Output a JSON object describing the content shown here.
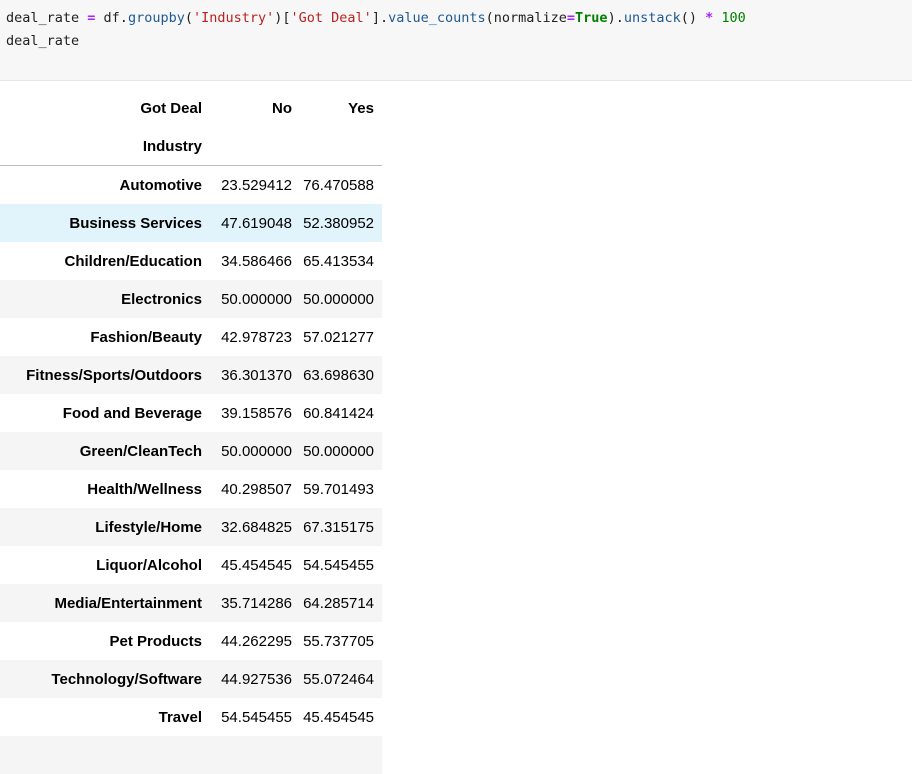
{
  "code": {
    "line1": {
      "var": "deal_rate ",
      "eq": "=",
      "obj": " df.",
      "fn1": "groupby",
      "p1": "(",
      "str1": "'Industry'",
      "p2": ")[",
      "str2": "'Got Deal'",
      "p3": "].",
      "fn2": "value_counts",
      "p4": "(normalize",
      "eq2": "=",
      "kw": "True",
      "p5": ").",
      "fn3": "unstack",
      "p6": "() ",
      "op": "*",
      "sp": " ",
      "num": "100"
    },
    "line2": "deal_rate"
  },
  "table": {
    "columns_name": "Got Deal",
    "index_name": "Industry",
    "columns": [
      "No",
      "Yes"
    ],
    "rows": [
      {
        "industry": "Automotive",
        "no": "23.529412",
        "yes": "76.470588"
      },
      {
        "industry": "Business Services",
        "no": "47.619048",
        "yes": "52.380952"
      },
      {
        "industry": "Children/Education",
        "no": "34.586466",
        "yes": "65.413534"
      },
      {
        "industry": "Electronics",
        "no": "50.000000",
        "yes": "50.000000"
      },
      {
        "industry": "Fashion/Beauty",
        "no": "42.978723",
        "yes": "57.021277"
      },
      {
        "industry": "Fitness/Sports/Outdoors",
        "no": "36.301370",
        "yes": "63.698630"
      },
      {
        "industry": "Food and Beverage",
        "no": "39.158576",
        "yes": "60.841424"
      },
      {
        "industry": "Green/CleanTech",
        "no": "50.000000",
        "yes": "50.000000"
      },
      {
        "industry": "Health/Wellness",
        "no": "40.298507",
        "yes": "59.701493"
      },
      {
        "industry": "Lifestyle/Home",
        "no": "32.684825",
        "yes": "67.315175"
      },
      {
        "industry": "Liquor/Alcohol",
        "no": "45.454545",
        "yes": "54.545455"
      },
      {
        "industry": "Media/Entertainment",
        "no": "35.714286",
        "yes": "64.285714"
      },
      {
        "industry": "Pet Products",
        "no": "44.262295",
        "yes": "55.737705"
      },
      {
        "industry": "Technology/Software",
        "no": "44.927536",
        "yes": "55.072464"
      },
      {
        "industry": "Travel",
        "no": "54.545455",
        "yes": "45.454545"
      },
      {
        "industry": "",
        "no": "",
        "yes": ""
      }
    ]
  }
}
